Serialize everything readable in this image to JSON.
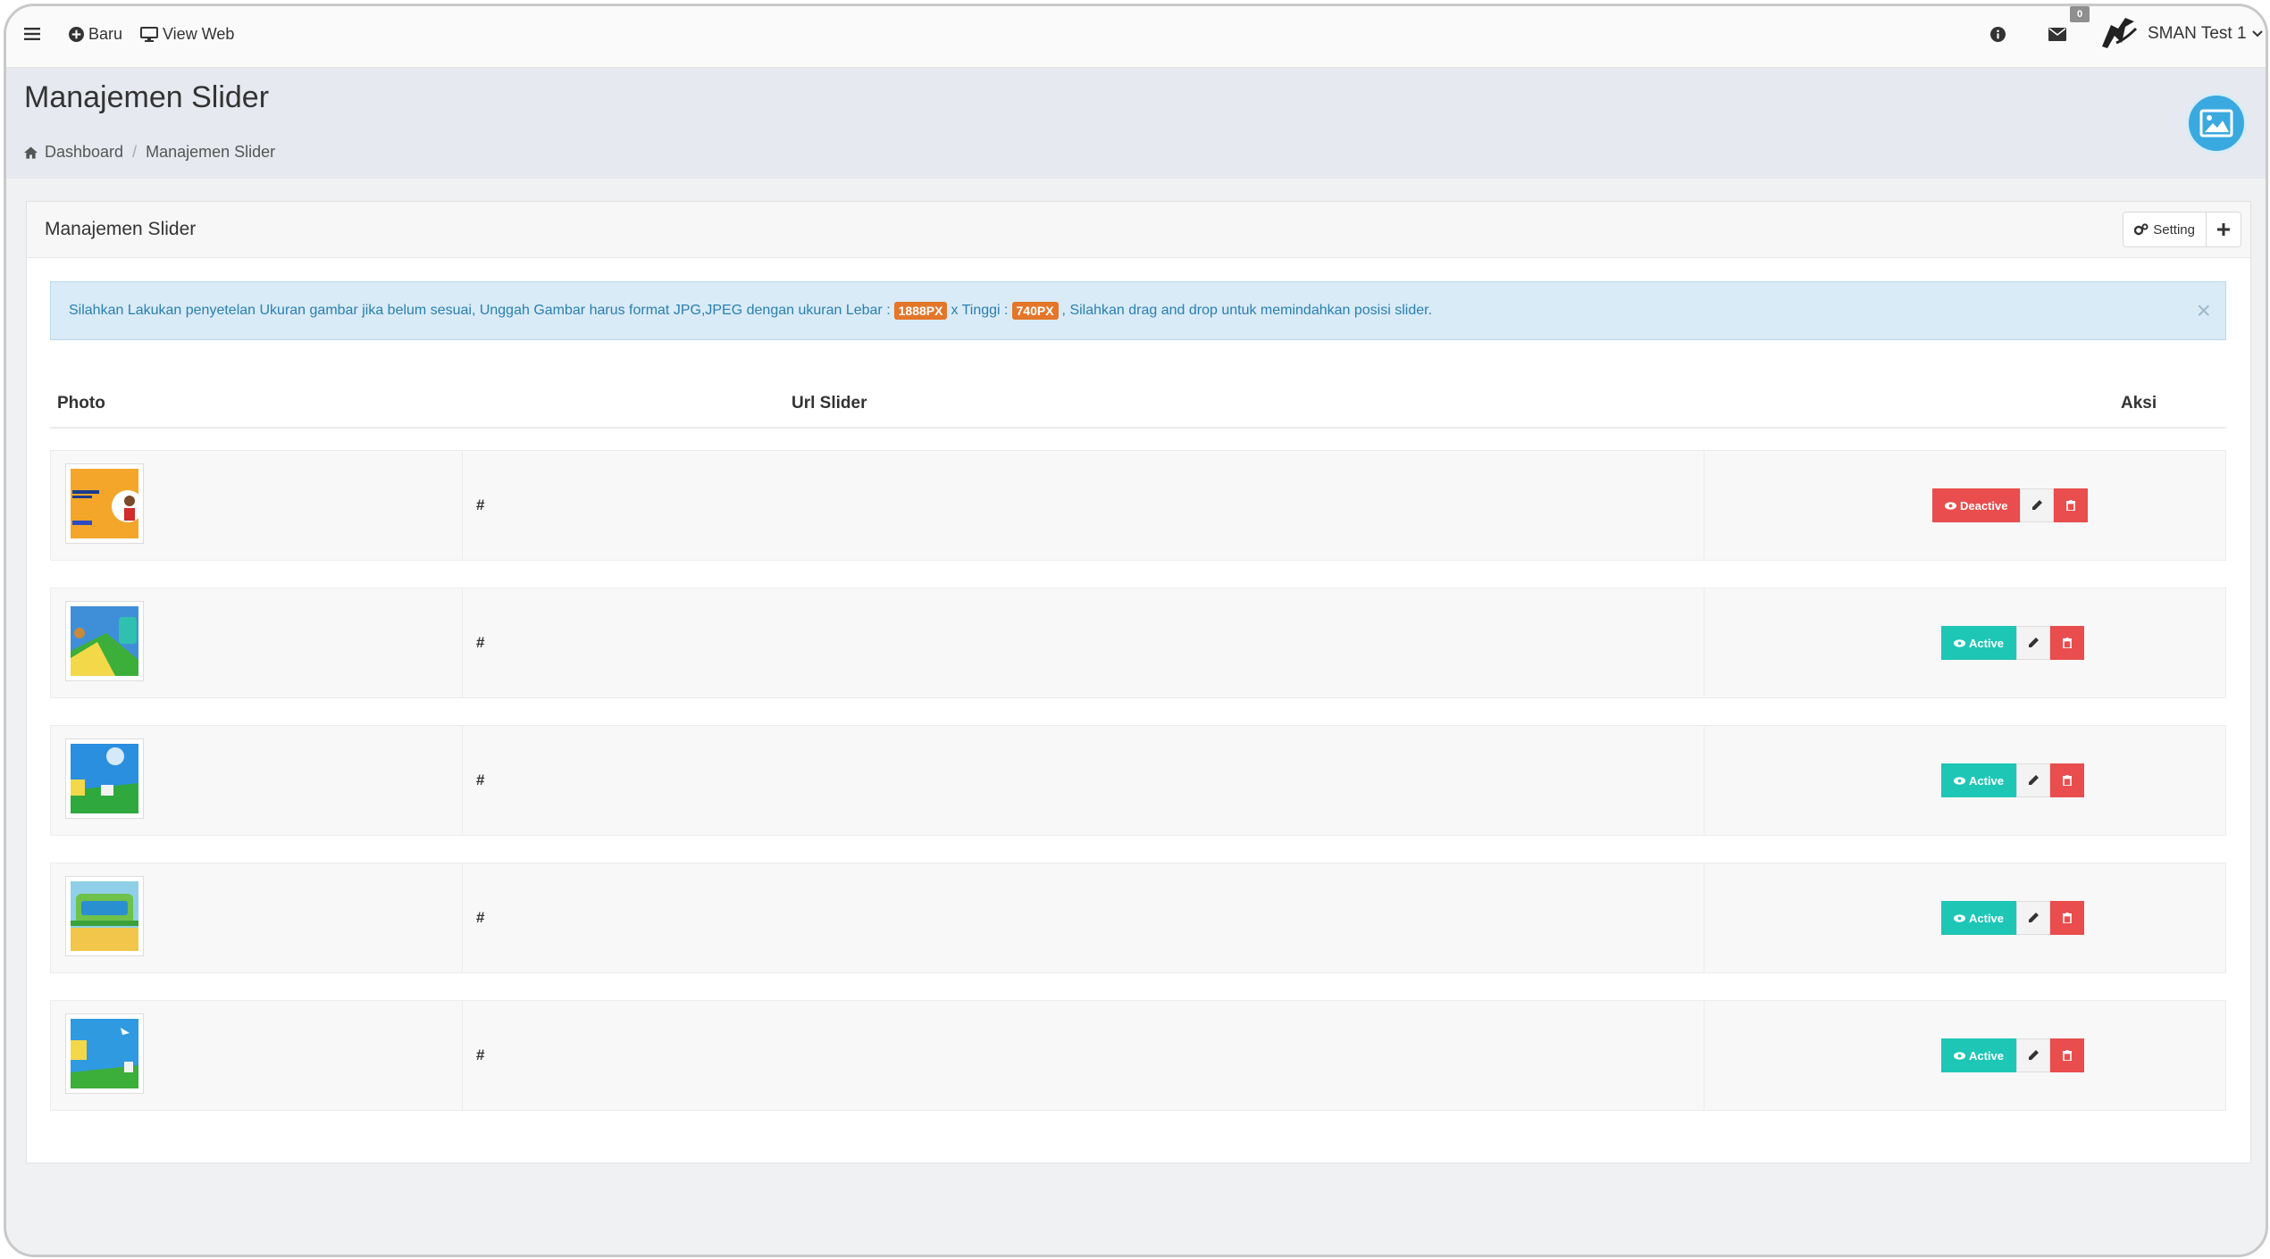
{
  "nav": {
    "new_label": "Baru",
    "view_web_label": "View Web",
    "mail_count": "0",
    "user_name": "SMAN Test 1"
  },
  "header": {
    "title": "Manajemen Slider",
    "breadcrumb": [
      "Dashboard",
      "Manajemen Slider"
    ]
  },
  "panel": {
    "title": "Manajemen Slider",
    "setting_label": "Setting",
    "alert": {
      "text_before": "Silahkan Lakukan penyetelan Ukuran gambar jika belum sesuai, Unggah Gambar harus format JPG,JPEG dengan ukuran Lebar :",
      "width_label": "1888PX",
      "text_middle": "x Tinggi :",
      "height_label": "740PX",
      "text_after": ", Silahkan drag and drop untuk memindahkan posisi slider."
    }
  },
  "table": {
    "headers": [
      "Photo",
      "Url Slider",
      "Aksi"
    ],
    "rows": [
      {
        "url": "#",
        "status": "Deactive"
      },
      {
        "url": "#",
        "status": "Active"
      },
      {
        "url": "#",
        "status": "Active"
      },
      {
        "url": "#",
        "status": "Active"
      },
      {
        "url": "#",
        "status": "Active"
      }
    ]
  },
  "colors": {
    "deactive": "#e94d4d",
    "active": "#1ec6b6",
    "header_icon": "#3aa9e0",
    "alert_bg": "#d9ebf7",
    "label_orange": "#e4762a"
  }
}
